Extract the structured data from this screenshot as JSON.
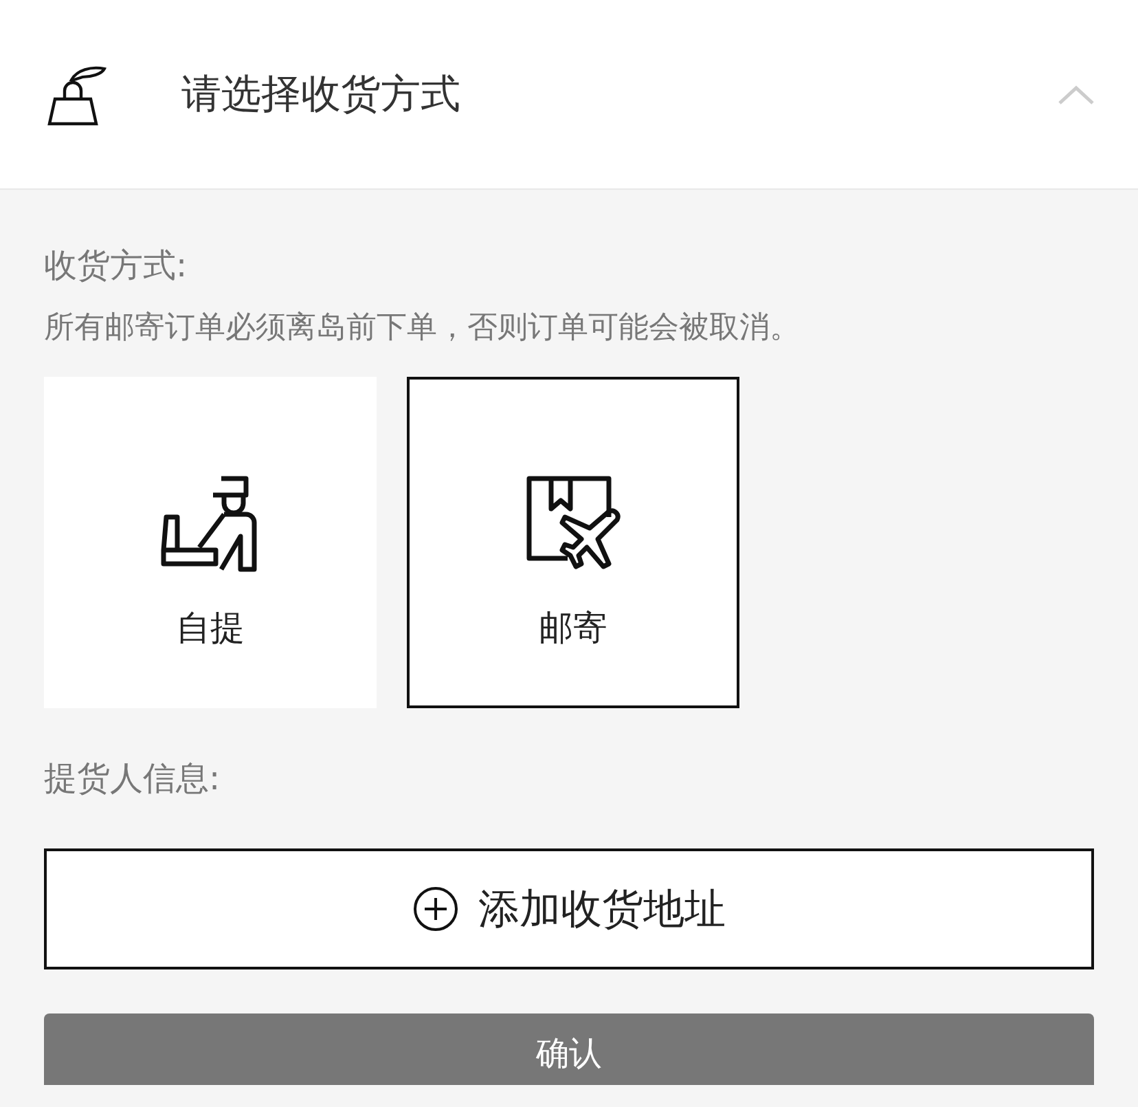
{
  "header": {
    "title": "请选择收货方式",
    "expanded": true
  },
  "delivery": {
    "label": "收货方式:",
    "notice": "所有邮寄订单必须离岛前下单，否则订单可能会被取消。",
    "options": [
      {
        "kind": "pickup",
        "label": "自提",
        "selected": false
      },
      {
        "kind": "mail",
        "label": "邮寄",
        "selected": true
      }
    ]
  },
  "recipient": {
    "label": "提货人信息:",
    "add_button": "添加收货地址"
  },
  "confirm_button": "确认"
}
